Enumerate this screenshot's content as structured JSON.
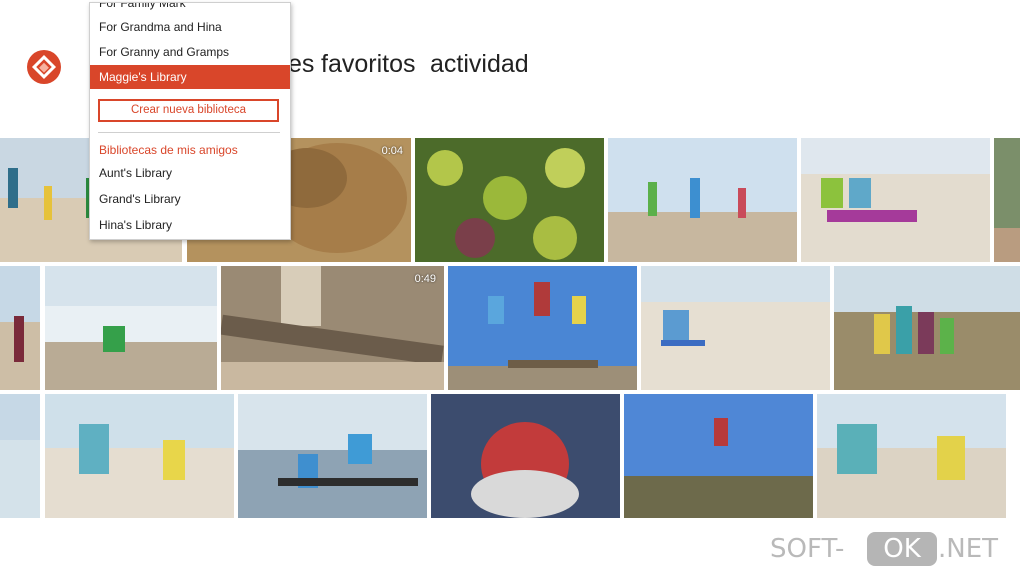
{
  "nav": {
    "partial_item": "es",
    "items": [
      "favoritos",
      "actividad"
    ]
  },
  "library_menu": {
    "clipped_item": "For Family Mark",
    "libraries": [
      "For Grandma and Hina",
      "For Granny and Gramps",
      "Maggie's Library"
    ],
    "selected_index": 2,
    "create_button": "Crear nueva biblioteca",
    "friends_header": "Bibliotecas de mis amigos",
    "friend_libraries": [
      "Aunt's Library",
      "Grand's Library",
      "Hina's Library"
    ]
  },
  "photos": {
    "video_durations": [
      "0:04",
      "0:49"
    ]
  },
  "watermark": {
    "soft": "SOFT-",
    "ok": "OK",
    "net": ".NET"
  },
  "colors": {
    "accent": "#d9462a"
  }
}
